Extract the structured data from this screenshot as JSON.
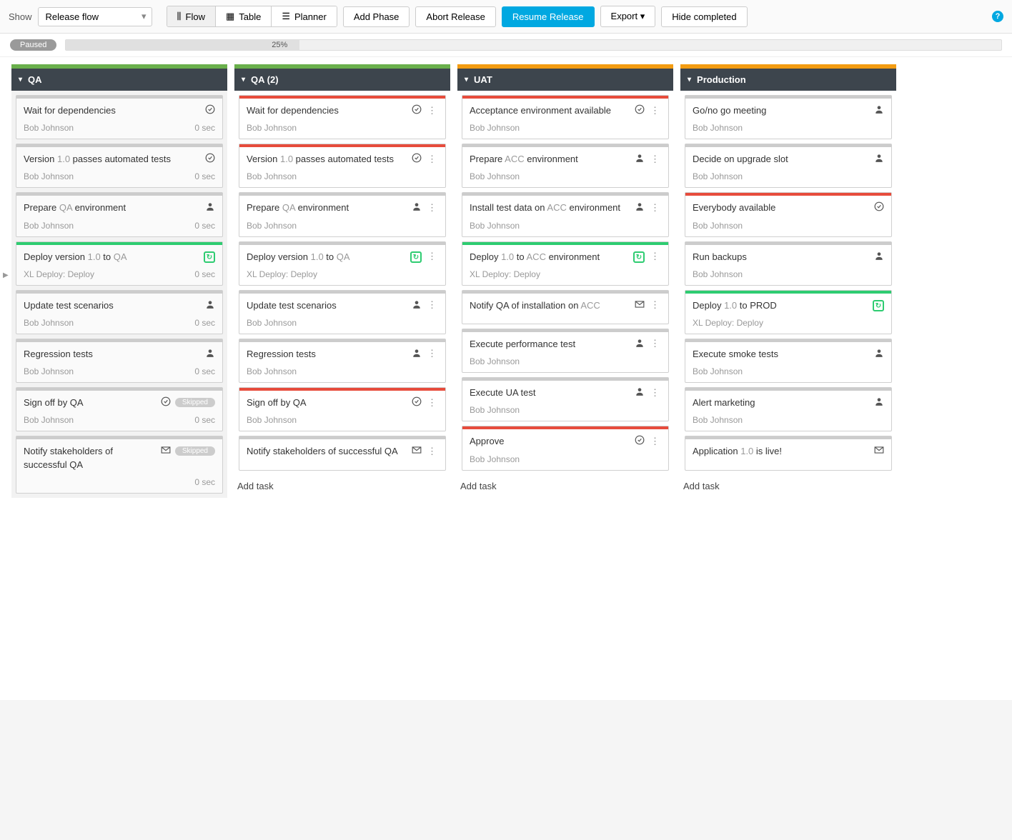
{
  "toolbar": {
    "show_label": "Show",
    "view_select": "Release flow",
    "tabs": {
      "flow": "Flow",
      "table": "Table",
      "planner": "Planner"
    },
    "buttons": {
      "add_phase": "Add Phase",
      "abort": "Abort Release",
      "resume": "Resume Release",
      "export": "Export",
      "hide_completed": "Hide completed"
    }
  },
  "status": {
    "badge": "Paused",
    "percent": "25%"
  },
  "phases": [
    {
      "name": "QA",
      "color": "green",
      "done": true,
      "tasks": [
        {
          "top": "gray",
          "title_plain": "Wait for dependencies",
          "owner": "Bob Johnson",
          "right": "0 sec",
          "icon": "check"
        },
        {
          "top": "gray",
          "title_pre": "Version ",
          "title_mut": "1.0",
          "title_post": " passes automated tests",
          "owner": "Bob Johnson",
          "right": "0 sec",
          "icon": "check"
        },
        {
          "top": "gray",
          "title_pre": "Prepare ",
          "title_mut": "QA",
          "title_post": " environment",
          "owner": "Bob Johnson",
          "right": "0 sec",
          "icon": "user"
        },
        {
          "top": "green",
          "title_pre": "Deploy version ",
          "title_mut": "1.0",
          "title_mid": " to ",
          "title_mut2": "QA",
          "owner": "XL Deploy: Deploy",
          "right": "0 sec",
          "icon": "deploy"
        },
        {
          "top": "gray",
          "title_plain": "Update test scenarios",
          "owner": "Bob Johnson",
          "right": "0 sec",
          "icon": "user"
        },
        {
          "top": "gray",
          "title_plain": "Regression tests",
          "owner": "Bob Johnson",
          "right": "0 sec",
          "icon": "user"
        },
        {
          "top": "gray",
          "title_plain": "Sign off by QA",
          "owner": "Bob Johnson",
          "right": "0 sec",
          "icon": "check",
          "skipped": "Skipped"
        },
        {
          "top": "gray",
          "title_plain": "Notify stakeholders of successful QA",
          "owner": "",
          "right": "0 sec",
          "icon": "mail",
          "skipped": "Skipped"
        }
      ]
    },
    {
      "name": "QA (2)",
      "color": "green",
      "tasks": [
        {
          "top": "red",
          "title_plain": "Wait for dependencies",
          "owner": "Bob Johnson",
          "icon": "check",
          "more": true
        },
        {
          "top": "red",
          "title_pre": "Version ",
          "title_mut": "1.0",
          "title_post": " passes automated tests",
          "owner": "Bob Johnson",
          "icon": "check",
          "more": true
        },
        {
          "top": "gray",
          "title_pre": "Prepare ",
          "title_mut": "QA",
          "title_post": " environment",
          "owner": "Bob Johnson",
          "icon": "user",
          "more": true
        },
        {
          "top": "gray",
          "title_pre": "Deploy version ",
          "title_mut": "1.0",
          "title_mid": " to ",
          "title_mut2": "QA",
          "owner": "XL Deploy: Deploy",
          "icon": "deploy",
          "more": true
        },
        {
          "top": "gray",
          "title_plain": "Update test scenarios",
          "owner": "Bob Johnson",
          "icon": "user",
          "more": true
        },
        {
          "top": "gray",
          "title_plain": "Regression tests",
          "owner": "Bob Johnson",
          "icon": "user",
          "more": true
        },
        {
          "top": "red",
          "title_plain": "Sign off by QA",
          "owner": "Bob Johnson",
          "icon": "check",
          "more": true
        },
        {
          "top": "gray",
          "title_plain": "Notify stakeholders of successful QA",
          "owner": "",
          "icon": "mail",
          "more": true
        }
      ],
      "add_task": "Add task"
    },
    {
      "name": "UAT",
      "color": "orange",
      "tasks": [
        {
          "top": "red",
          "title_plain": "Acceptance environment available",
          "owner": "Bob Johnson",
          "icon": "check",
          "more": true
        },
        {
          "top": "gray",
          "title_pre": "Prepare ",
          "title_mut": "ACC",
          "title_post": " environment",
          "owner": "Bob Johnson",
          "icon": "user",
          "more": true
        },
        {
          "top": "gray",
          "title_pre": "Install test data on ",
          "title_mut": "ACC",
          "title_post": " environment",
          "owner": "Bob Johnson",
          "icon": "user",
          "more": true
        },
        {
          "top": "green",
          "title_pre": "Deploy ",
          "title_mut": "1.0",
          "title_mid": " to ",
          "title_mut2": "ACC",
          "title_post": " environment",
          "owner": "XL Deploy: Deploy",
          "icon": "deploy",
          "more": true
        },
        {
          "top": "gray",
          "title_pre": "Notify QA of installation on ",
          "title_mut": "ACC",
          "owner": "",
          "icon": "mail",
          "more": true
        },
        {
          "top": "gray",
          "title_plain": "Execute performance test",
          "owner": "Bob Johnson",
          "icon": "user",
          "more": true
        },
        {
          "top": "gray",
          "title_plain": "Execute UA test",
          "owner": "Bob Johnson",
          "icon": "user",
          "more": true
        },
        {
          "top": "red",
          "title_plain": "Approve",
          "owner": "Bob Johnson",
          "icon": "check",
          "more": true
        }
      ],
      "add_task": "Add task"
    },
    {
      "name": "Production",
      "color": "orange",
      "tasks": [
        {
          "top": "gray",
          "title_plain": "Go/no go meeting",
          "owner": "Bob Johnson",
          "icon": "user"
        },
        {
          "top": "gray",
          "title_plain": "Decide on upgrade slot",
          "owner": "Bob Johnson",
          "icon": "user"
        },
        {
          "top": "red",
          "title_plain": "Everybody available",
          "owner": "Bob Johnson",
          "icon": "check"
        },
        {
          "top": "gray",
          "title_plain": "Run backups",
          "owner": "Bob Johnson",
          "icon": "user"
        },
        {
          "top": "green",
          "title_pre": "Deploy ",
          "title_mut": "1.0",
          "title_post": " to PROD",
          "owner": "XL Deploy: Deploy",
          "icon": "deploy"
        },
        {
          "top": "gray",
          "title_plain": "Execute smoke tests",
          "owner": "Bob Johnson",
          "icon": "user"
        },
        {
          "top": "gray",
          "title_plain": "Alert marketing",
          "owner": "Bob Johnson",
          "icon": "user"
        },
        {
          "top": "gray",
          "title_pre": "Application ",
          "title_mut": "1.0",
          "title_post": " is live!",
          "owner": "",
          "icon": "mail"
        }
      ],
      "add_task": "Add task"
    }
  ]
}
